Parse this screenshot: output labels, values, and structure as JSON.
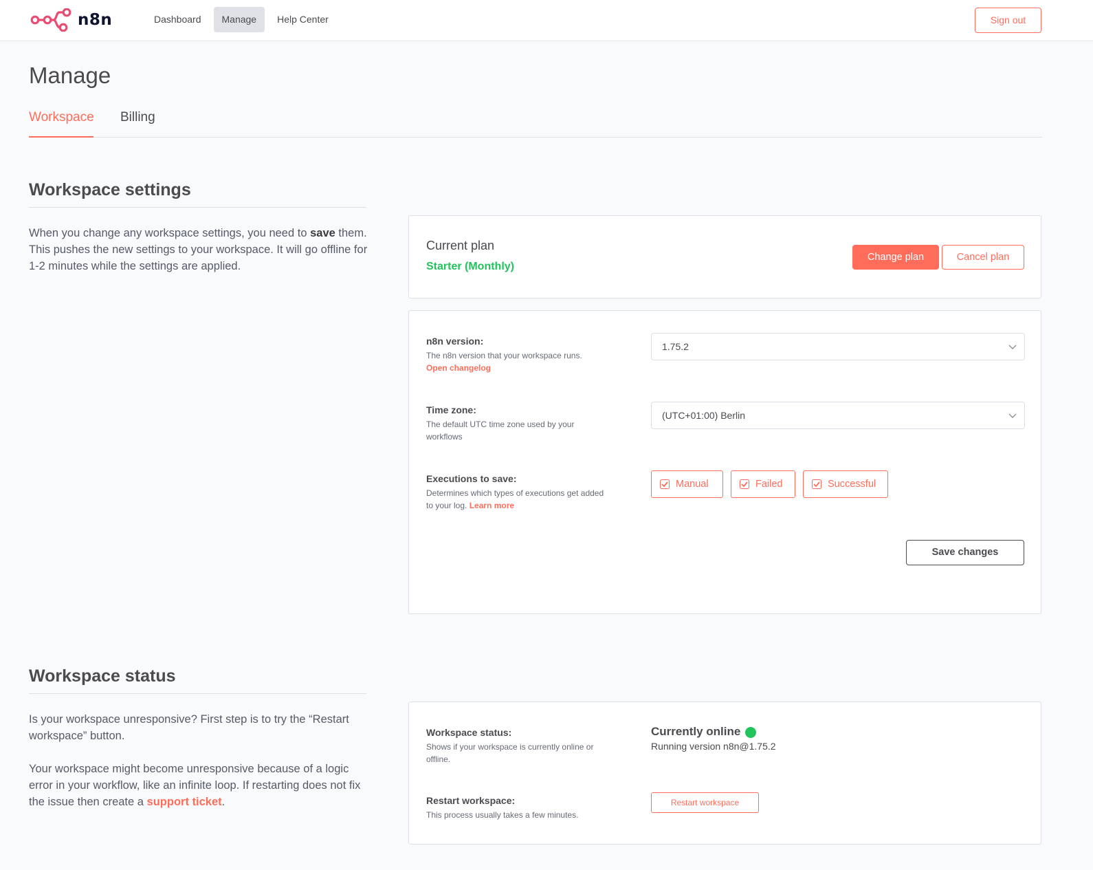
{
  "app": {
    "brand": "n8n",
    "brand_color": "#ff6d5a",
    "logo_color": "#ea4b71"
  },
  "nav": {
    "items": [
      "Dashboard",
      "Manage",
      "Help Center"
    ],
    "active": "Manage",
    "sign_out": "Sign out"
  },
  "page": {
    "title": "Manage",
    "tabs": [
      {
        "label": "Workspace",
        "active": true
      },
      {
        "label": "Billing",
        "active": false
      }
    ]
  },
  "settings": {
    "title": "Workspace settings",
    "desc_pre": "When you change any workspace settings, you need to ",
    "desc_bold": "save",
    "desc_post": " them. This pushes the new settings to your workspace. It will go offline for 1-2 minutes while the settings are applied.",
    "plan": {
      "label": "Current plan",
      "value": "Starter (Monthly)",
      "change_button": "Change plan",
      "cancel_button": "Cancel plan"
    },
    "version": {
      "label": "n8n version:",
      "help": "The n8n version that your workspace runs.",
      "link": "Open changelog",
      "value": "1.75.2",
      "icon": "chevron-down-icon"
    },
    "timezone": {
      "label": "Time zone:",
      "help": "The default UTC time zone used by your workflows",
      "value": "(UTC+01:00) Berlin",
      "icon": "chevron-down-icon"
    },
    "executions": {
      "label": "Executions to save:",
      "help": "Determines which types of executions get added to your log. ",
      "link": "Learn more",
      "options": [
        {
          "label": "Manual",
          "checked": true
        },
        {
          "label": "Failed",
          "checked": true
        },
        {
          "label": "Successful",
          "checked": true
        }
      ]
    },
    "save_button": "Save changes"
  },
  "status": {
    "title": "Workspace status",
    "desc1": "Is your workspace unresponsive? First step is to try the “Restart workspace” button.",
    "desc2_pre": "Your workspace might become unresponsive because of a logic error in your workflow, like an infinite loop. If restarting does not fix the issue then create a ",
    "desc2_link": "support ticket",
    "desc2_post": ".",
    "status_label": "Workspace status:",
    "status_help": "Shows if your workspace is currently online or offline.",
    "status_value": "Currently online",
    "status_color": "#20c35c",
    "running_version": "Running version n8n@1.75.2",
    "restart_label": "Restart workspace:",
    "restart_help": "This process usually takes a few minutes.",
    "restart_button": "Restart workspace"
  }
}
